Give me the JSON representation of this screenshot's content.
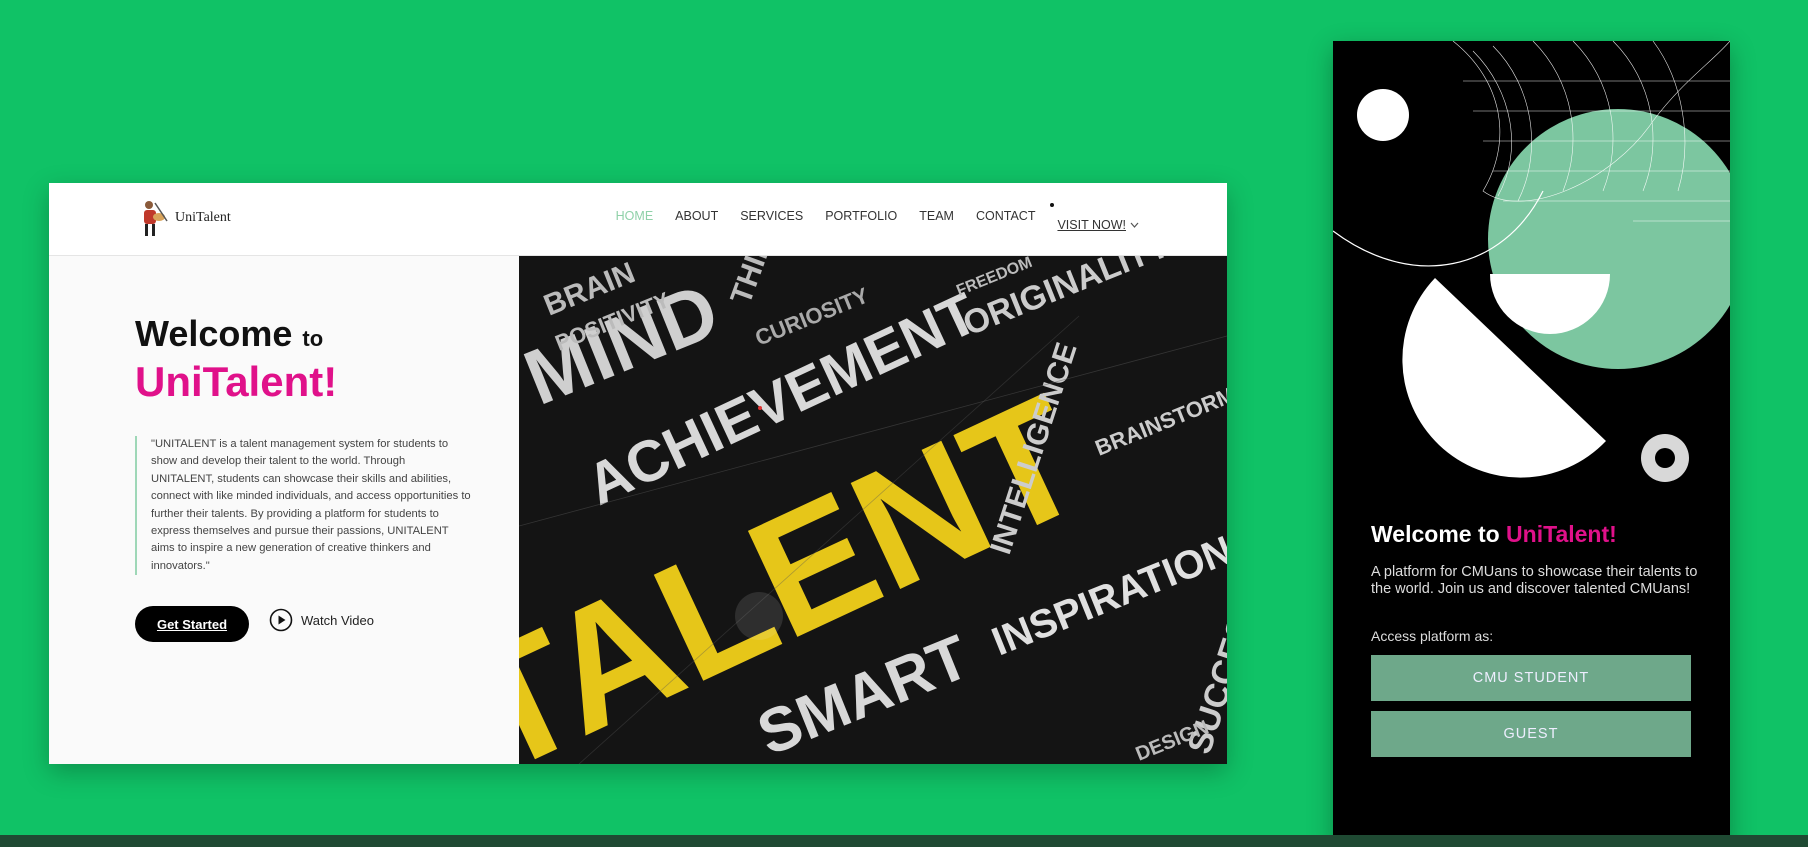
{
  "desktop": {
    "logo_text": "UniTalent",
    "nav": {
      "home": "HOME",
      "about": "ABOUT",
      "services": "SERVICES",
      "portfolio": "PORTFOLIO",
      "team": "TEAM",
      "contact": "CONTACT",
      "visit": "VISIT NOW!"
    },
    "hero": {
      "welcome": "Welcome",
      "to": "to",
      "brand": "UniTalent!",
      "quote": "\"UNITALENT is a talent management system for students to show and develop their talent to the world. Through UNITALENT, students can showcase their skills and abilities, connect with like minded individuals, and access opportunities to further their talents. By providing a platform for students to express themselves and pursue their passions, UNITALENT aims to inspire a new generation of creative thinkers and innovators.\"",
      "get_started": "Get Started",
      "watch_video": "Watch Video"
    },
    "collage_words": [
      "MIND",
      "ACHIEVEMENT",
      "TALENT",
      "BRAIN",
      "POSITIVITY",
      "CURIOSITY",
      "ORIGINALITY",
      "FREEDOM",
      "INTELLIGENCE",
      "INSPIRATION",
      "SMART",
      "SUCCESS",
      "DESIGN",
      "BRAINSTORM",
      "THINK"
    ]
  },
  "mobile": {
    "welcome": "Welcome to",
    "brand": "UniTalent!",
    "description": "A platform for CMUans to showcase their talents to the world. Join us and discover talented CMUans!",
    "access_label": "Access platform as:",
    "btn_student": "CMU STUDENT",
    "btn_guest": "GUEST"
  },
  "colors": {
    "background": "#10c266",
    "brand_pink": "#e0118a",
    "mint": "#6ea88a",
    "collage_yellow": "#e6c619"
  },
  "icons": [
    "logo-icon",
    "chevron-down-icon",
    "play-icon"
  ]
}
